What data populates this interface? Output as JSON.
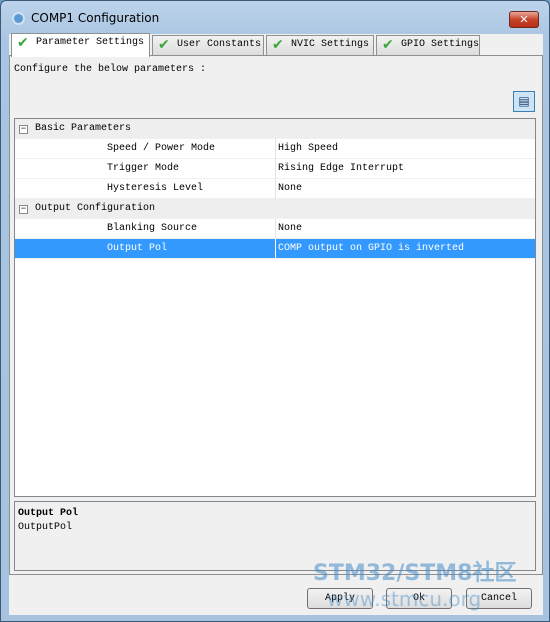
{
  "window": {
    "title": "COMP1 Configuration",
    "close_icon": "close-icon"
  },
  "tabs": [
    {
      "label": "Parameter Settings",
      "active": true
    },
    {
      "label": "User Constants"
    },
    {
      "label": "NVIC Settings"
    },
    {
      "label": "GPIO Settings"
    }
  ],
  "intro": "Configure the below parameters :",
  "groups": [
    {
      "label": "Basic Parameters",
      "rows": [
        {
          "name": "Speed / Power Mode",
          "value": "High Speed"
        },
        {
          "name": "Trigger Mode",
          "value": "Rising Edge Interrupt"
        },
        {
          "name": "Hysteresis Level",
          "value": "None"
        }
      ]
    },
    {
      "label": "Output Configuration",
      "rows": [
        {
          "name": "Blanking Source",
          "value": "None"
        },
        {
          "name": "Output Pol",
          "value": "COMP output on GPIO is inverted",
          "selected": true
        }
      ]
    }
  ],
  "description": {
    "title": "Output Pol",
    "text": "OutputPol"
  },
  "buttons": {
    "apply": "Apply",
    "ok": "Ok",
    "cancel": "Cancel"
  },
  "watermark": {
    "line1": "STM32/STM8社区",
    "line2": "www.stmcu.org"
  },
  "colors": {
    "selection": "#3399ff",
    "check": "#3ca63c"
  }
}
